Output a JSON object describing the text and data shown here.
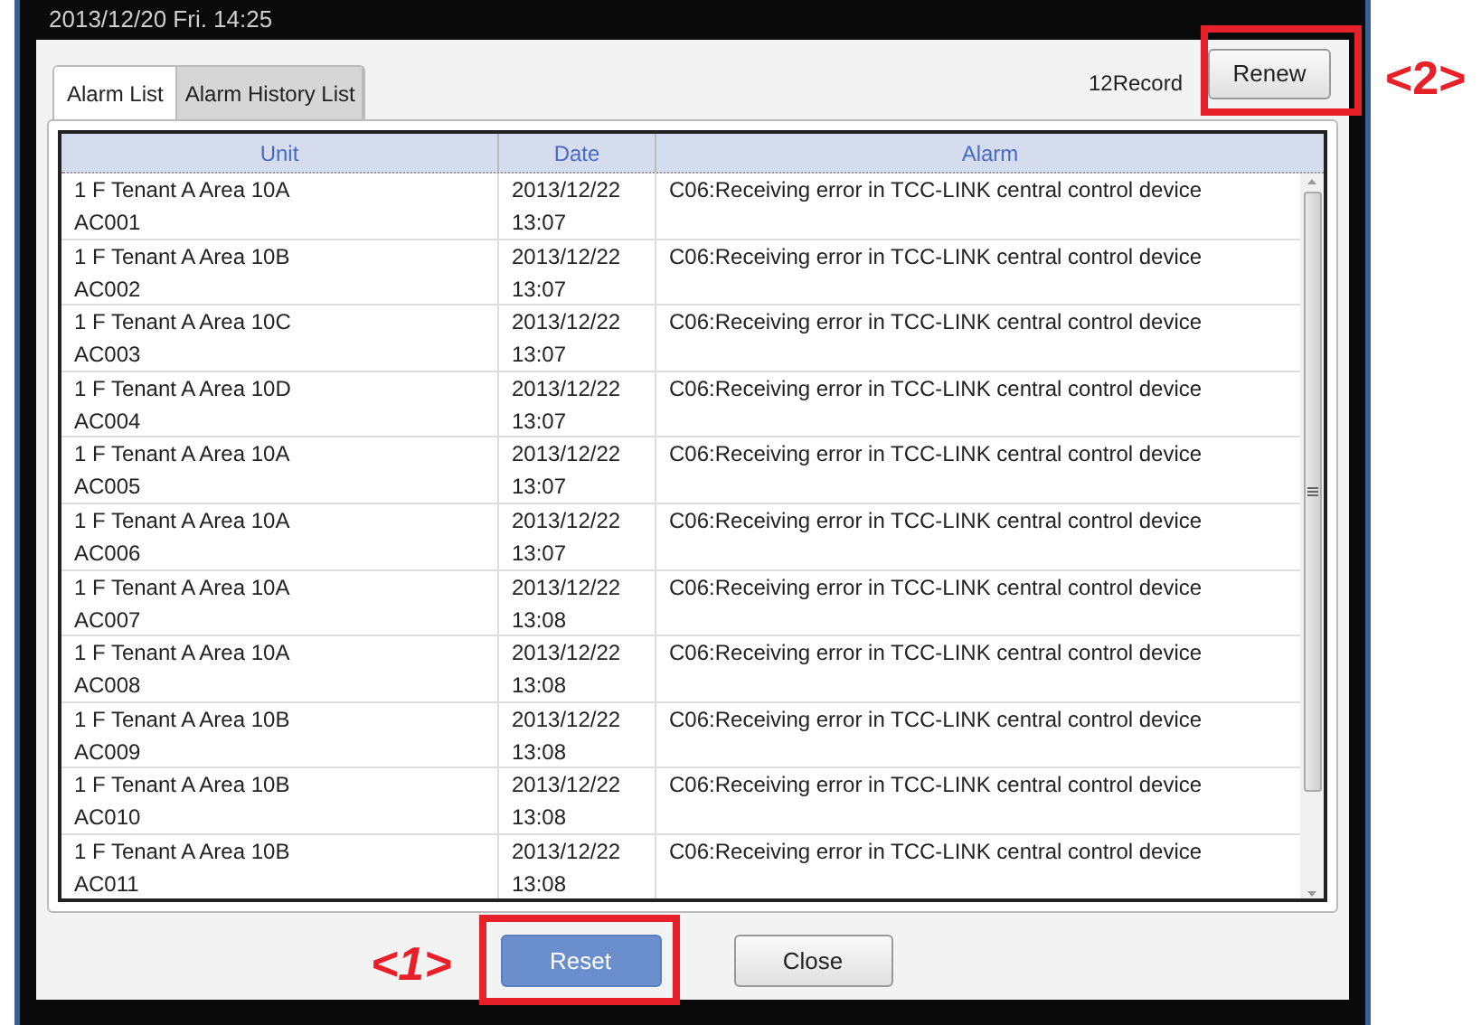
{
  "status_bar": {
    "datetime": "2013/12/20  Fri.  14:25"
  },
  "tabs": [
    {
      "label": "Alarm List",
      "selected": true
    },
    {
      "label": "Alarm History List",
      "selected": false
    }
  ],
  "record_count": "12Record",
  "renew_button": {
    "label": "Renew"
  },
  "table": {
    "columns": [
      "Unit",
      "Date",
      "Alarm"
    ],
    "rows": [
      {
        "unit": [
          "1 F Tenant A Area 10A",
          "AC001"
        ],
        "date": [
          "2013/12/22",
          "13:07"
        ],
        "alarm": "C06:Receiving error in TCC-LINK central control device"
      },
      {
        "unit": [
          "1 F Tenant A Area 10B",
          "AC002"
        ],
        "date": [
          "2013/12/22",
          "13:07"
        ],
        "alarm": "C06:Receiving error in TCC-LINK central control device"
      },
      {
        "unit": [
          "1 F Tenant A Area 10C",
          "AC003"
        ],
        "date": [
          "2013/12/22",
          "13:07"
        ],
        "alarm": "C06:Receiving error in TCC-LINK central control device"
      },
      {
        "unit": [
          "1 F Tenant A Area 10D",
          "AC004"
        ],
        "date": [
          "2013/12/22",
          "13:07"
        ],
        "alarm": "C06:Receiving error in TCC-LINK central control device"
      },
      {
        "unit": [
          "1 F Tenant A Area 10A",
          "AC005"
        ],
        "date": [
          "2013/12/22",
          "13:07"
        ],
        "alarm": "C06:Receiving error in TCC-LINK central control device"
      },
      {
        "unit": [
          "1 F Tenant A Area 10A",
          "AC006"
        ],
        "date": [
          "2013/12/22",
          "13:07"
        ],
        "alarm": "C06:Receiving error in TCC-LINK central control device"
      },
      {
        "unit": [
          "1 F Tenant A Area 10A",
          "AC007"
        ],
        "date": [
          "2013/12/22",
          "13:08"
        ],
        "alarm": "C06:Receiving error in TCC-LINK central control device"
      },
      {
        "unit": [
          "1 F Tenant A Area 10A",
          "AC008"
        ],
        "date": [
          "2013/12/22",
          "13:08"
        ],
        "alarm": "C06:Receiving error in TCC-LINK central control device"
      },
      {
        "unit": [
          "1 F Tenant A Area 10B",
          "AC009"
        ],
        "date": [
          "2013/12/22",
          "13:08"
        ],
        "alarm": "C06:Receiving error in TCC-LINK central control device"
      },
      {
        "unit": [
          "1 F Tenant A Area 10B",
          "AC010"
        ],
        "date": [
          "2013/12/22",
          "13:08"
        ],
        "alarm": "C06:Receiving error in TCC-LINK central control device"
      },
      {
        "unit": [
          "1 F Tenant A Area 10B",
          "AC011"
        ],
        "date": [
          "2013/12/22",
          "13:08"
        ],
        "alarm": "C06:Receiving error in TCC-LINK central control device"
      }
    ]
  },
  "buttons": [
    {
      "kind": "primary",
      "label": "Reset",
      "callout": "<1>"
    },
    {
      "kind": "secondary",
      "label": "Close"
    }
  ],
  "renew_callout": "<2>"
}
